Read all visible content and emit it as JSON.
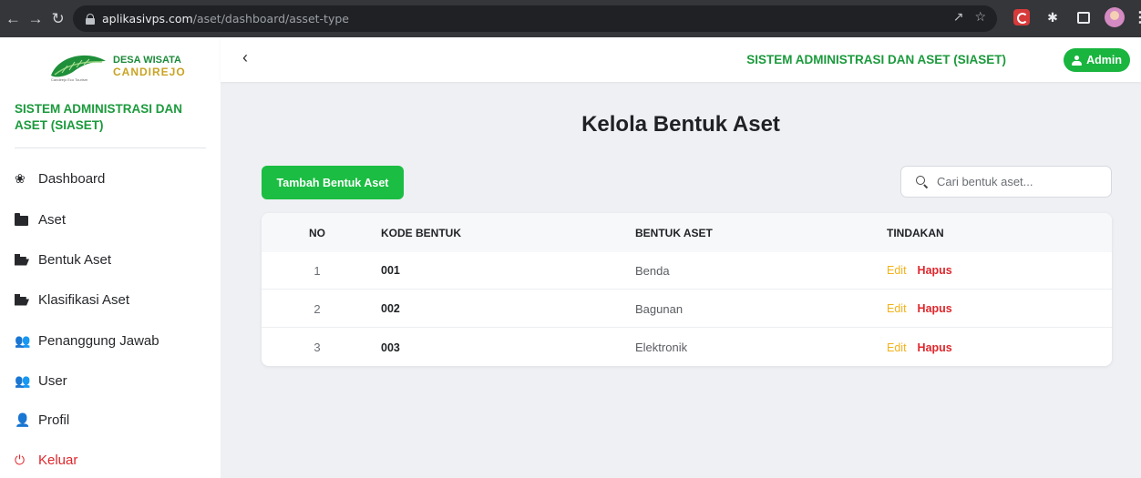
{
  "browser": {
    "url_host": "aplikasivps.com",
    "url_path": "/aset/dashboard/asset-type"
  },
  "logo": {
    "line1": "DESA WISATA",
    "line2": "CANDIREJO",
    "tagline": "Candirejo Eco Tourism"
  },
  "sidebar": {
    "title": "SISTEM ADMINISTRASI DAN ASET (SIASET)",
    "items": [
      {
        "label": "Dashboard",
        "icon": "palette-icon"
      },
      {
        "label": "Aset",
        "icon": "folder-icon"
      },
      {
        "label": "Bentuk Aset",
        "icon": "folder-open-icon"
      },
      {
        "label": "Klasifikasi Aset",
        "icon": "folder-open-icon"
      },
      {
        "label": "Penanggung Jawab",
        "icon": "users-icon"
      },
      {
        "label": "User",
        "icon": "users-icon"
      },
      {
        "label": "Profil",
        "icon": "user-cog-icon"
      },
      {
        "label": "Keluar",
        "icon": "power-icon"
      }
    ]
  },
  "header": {
    "title": "SISTEM ADMINISTRASI DAN ASET (SIASET)",
    "admin_label": "Admin"
  },
  "main": {
    "page_title": "Kelola Bentuk Aset",
    "add_button": "Tambah Bentuk Aset",
    "search_placeholder": "Cari bentuk aset...",
    "table": {
      "headers": [
        "NO",
        "KODE BENTUK",
        "BENTUK ASET",
        "TINDAKAN"
      ],
      "rows": [
        {
          "no": "1",
          "kode": "001",
          "bentuk": "Benda",
          "edit": "Edit",
          "hapus": "Hapus"
        },
        {
          "no": "2",
          "kode": "002",
          "bentuk": "Bagunan",
          "edit": "Edit",
          "hapus": "Hapus"
        },
        {
          "no": "3",
          "kode": "003",
          "bentuk": "Elektronik",
          "edit": "Edit",
          "hapus": "Hapus"
        }
      ]
    }
  },
  "colors": {
    "brand_green": "#1b9a3c",
    "button_green": "#1bbd42",
    "edit_yellow": "#f2b21a",
    "danger_red": "#e0262b"
  }
}
